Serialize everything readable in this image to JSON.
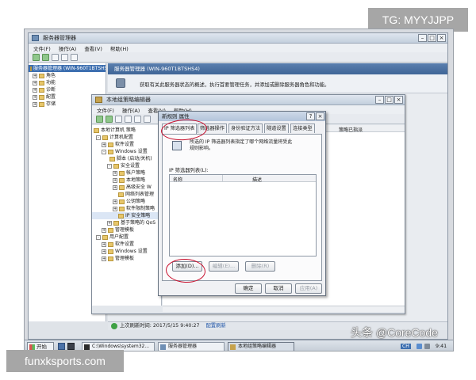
{
  "overlays": {
    "tg_label": "TG: MYYJJPP",
    "site_label": "funxksports.com",
    "watermark": "头条 @CoreCode"
  },
  "server_manager": {
    "title": "服务器管理器",
    "menu": [
      "文件(F)",
      "操作(A)",
      "查看(V)",
      "帮助(H)"
    ],
    "tree": [
      {
        "label": "服务器管理器 (WIN-960T1BTSHS4",
        "indent": 0,
        "selected": true
      },
      {
        "label": "角色",
        "indent": 1
      },
      {
        "label": "功能",
        "indent": 1
      },
      {
        "label": "诊断",
        "indent": 1
      },
      {
        "label": "配置",
        "indent": 1
      },
      {
        "label": "存储",
        "indent": 1
      }
    ],
    "header_title": "服务器管理器 (WIN-960T1BTSHS4)",
    "description": "获取有关此服务器状态的概述，执行首要管理任务，并添加或删除服务器角色和功能。",
    "status_bar": "上次刷新时间: 2017/5/15 9:40:27",
    "status_link": "配置刷新"
  },
  "gp_editor": {
    "title": "本地组策略编辑器",
    "menu": [
      "文件(F)",
      "操作(A)",
      "查看(V)",
      "帮助(H)"
    ],
    "tree": [
      {
        "label": "本地计算机 策略",
        "indent": 0
      },
      {
        "label": "计算机配置",
        "indent": 1
      },
      {
        "label": "软件设置",
        "indent": 2
      },
      {
        "label": "Windows 设置",
        "indent": 2
      },
      {
        "label": "脚本 (启动/关机)",
        "indent": 3
      },
      {
        "label": "安全设置",
        "indent": 3
      },
      {
        "label": "帐户策略",
        "indent": 4
      },
      {
        "label": "本地策略",
        "indent": 4
      },
      {
        "label": "高级安全 W",
        "indent": 4
      },
      {
        "label": "网络列表管理",
        "indent": 4
      },
      {
        "label": "公钥策略",
        "indent": 4
      },
      {
        "label": "软件限制策略",
        "indent": 4
      },
      {
        "label": "IP 安全策略",
        "indent": 4
      },
      {
        "label": "基于策略的 QoS",
        "indent": 3
      },
      {
        "label": "管理模板",
        "indent": 2
      },
      {
        "label": "用户配置",
        "indent": 1
      },
      {
        "label": "软件设置",
        "indent": 2
      },
      {
        "label": "Windows 设置",
        "indent": 2
      },
      {
        "label": "管理模板",
        "indent": 2
      }
    ],
    "right_header": "策略已指派"
  },
  "dialog": {
    "title": "新规则 属性",
    "tabs": [
      "IP 筛选器列表",
      "筛选器操作",
      "身份验证方法",
      "隧道设置",
      "连接类型"
    ],
    "description": "所选的 IP 筛选器列表指定了哪个网络流量将受此规则影响。",
    "list_label": "IP 筛选器列表(L):",
    "columns": [
      "名称",
      "描述"
    ],
    "buttons": {
      "add": "添加(D)...",
      "edit": "编辑(E)...",
      "remove": "删除(R)"
    },
    "footer": {
      "ok": "确定",
      "cancel": "取消",
      "apply": "应用(A)"
    }
  },
  "taskbar": {
    "start": "开始",
    "items": [
      "C:\\Windows\\system32...",
      "服务器管理器",
      "本地组策略编辑器"
    ],
    "lang": "CH",
    "clock": "9:41"
  }
}
